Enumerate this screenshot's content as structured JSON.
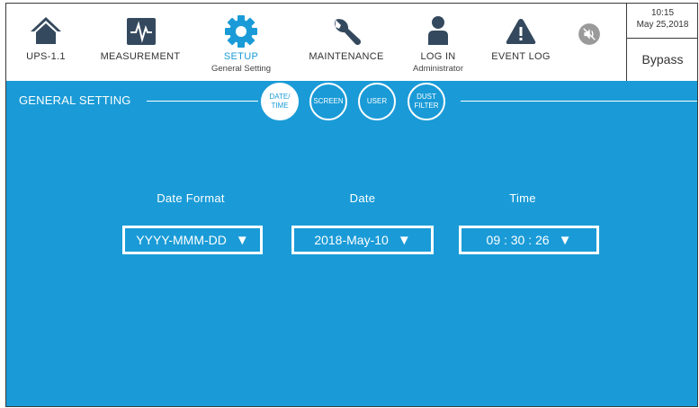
{
  "nav": {
    "ups": {
      "label": "UPS-1.1",
      "icon": "home-icon"
    },
    "measurement": {
      "label": "MEASUREMENT",
      "icon": "waveform-icon"
    },
    "setup": {
      "label": "SETUP",
      "sub": "General Setting",
      "icon": "gear-icon"
    },
    "maintenance": {
      "label": "MAINTENANCE",
      "icon": "wrench-icon"
    },
    "login": {
      "label": "LOG IN",
      "sub": "Administrator",
      "icon": "user-icon"
    },
    "eventlog": {
      "label": "EVENT LOG",
      "icon": "warning-icon"
    },
    "mute": {
      "icon": "speaker-mute-icon"
    }
  },
  "status": {
    "time": "10:15",
    "date": "May 25,2018",
    "mode": "Bypass"
  },
  "panel": {
    "title": "GENERAL SETTING",
    "tabs": {
      "datetime": "DATE/\nTIME",
      "screen": "SCREEN",
      "user": "USER",
      "dust": "DUST\nFILTER"
    },
    "date_format": {
      "label": "Date Format",
      "value": "YYYY-MMM-DD"
    },
    "date": {
      "label": "Date",
      "value": "2018-May-10"
    },
    "time": {
      "label": "Time",
      "value": "09 : 30 : 26"
    }
  },
  "colors": {
    "accent": "#1a9bd7",
    "icon_dark": "#34495e",
    "mute_bg": "#9a9a9a"
  }
}
